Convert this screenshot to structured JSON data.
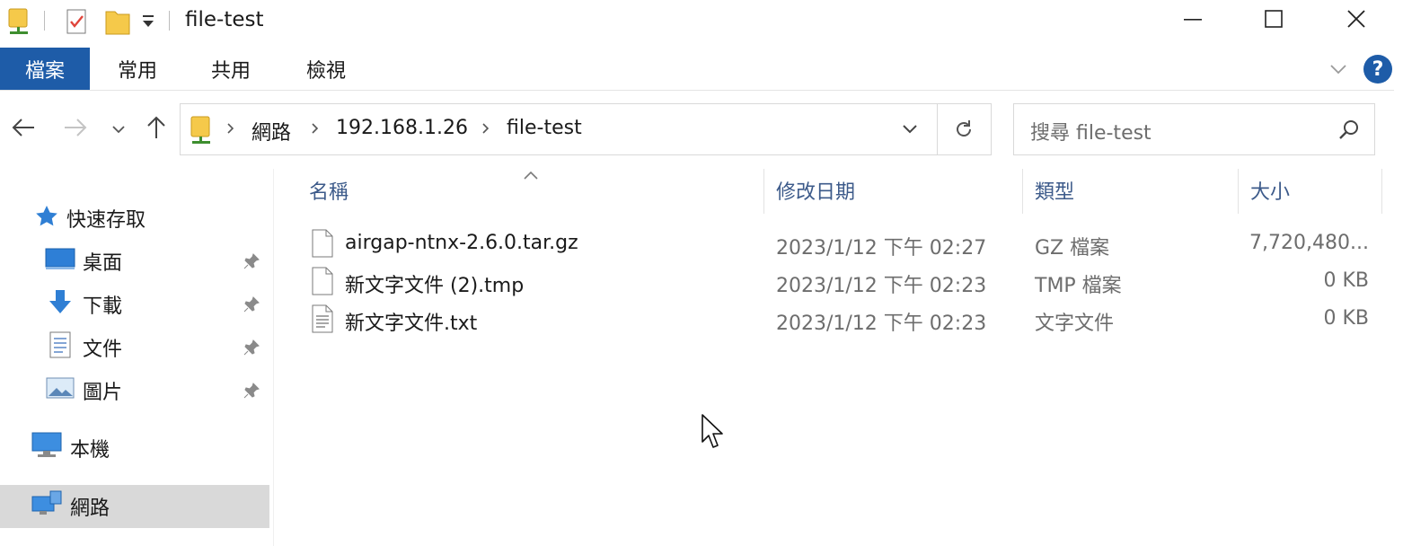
{
  "window": {
    "title": "file-test",
    "quick_access_icons": [
      "network-folder-icon",
      "properties-check-icon",
      "new-folder-icon",
      "customize-dropdown-icon"
    ],
    "controls": [
      "minimize-icon",
      "maximize-icon",
      "close-icon"
    ]
  },
  "ribbon": {
    "tabs": [
      {
        "label": "檔案",
        "active": true
      },
      {
        "label": "常用",
        "active": false
      },
      {
        "label": "共用",
        "active": false
      },
      {
        "label": "檢視",
        "active": false
      }
    ],
    "help_label": "?"
  },
  "address": {
    "crumbs": [
      "網路",
      "192.168.1.26",
      "file-test"
    ]
  },
  "search": {
    "placeholder": "搜尋 file-test"
  },
  "nav_pane": {
    "quick_access": "快速存取",
    "pinned": [
      {
        "label": "桌面",
        "icon": "desktop-icon"
      },
      {
        "label": "下載",
        "icon": "download-icon"
      },
      {
        "label": "文件",
        "icon": "documents-icon"
      },
      {
        "label": "圖片",
        "icon": "pictures-icon"
      }
    ],
    "this_pc": "本機",
    "network": "網路"
  },
  "details": {
    "columns": [
      "名稱",
      "修改日期",
      "類型",
      "大小"
    ],
    "files": [
      {
        "name": "airgap-ntnx-2.6.0.tar.gz",
        "modified": "2023/1/12 下午 02:27",
        "type": "GZ 檔案",
        "size": "7,720,480...",
        "icon": "file-icon"
      },
      {
        "name": "新文字文件 (2).tmp",
        "modified": "2023/1/12 下午 02:23",
        "type": "TMP 檔案",
        "size": "0 KB",
        "icon": "file-icon"
      },
      {
        "name": "新文字文件.txt",
        "modified": "2023/1/12 下午 02:23",
        "type": "文字文件",
        "size": "0 KB",
        "icon": "text-file-icon"
      }
    ]
  },
  "colors": {
    "accent": "#1e5ca8",
    "help": "#1e5ca8",
    "selection": "#d9d9d9"
  }
}
